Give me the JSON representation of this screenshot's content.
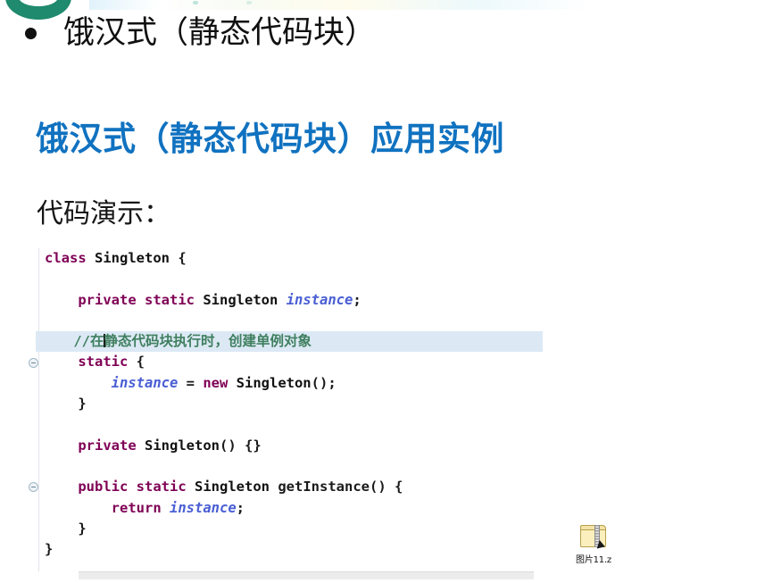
{
  "slide": {
    "bullet_title": "饿汉式（静态代码块）",
    "heading": "饿汉式（静态代码块）应用实例",
    "sub_label": "代码演示：",
    "heading_color": "#1072c0",
    "accent_ring_color": "#1f8a6d"
  },
  "code": {
    "language": "java",
    "highlight_background": "#dce9f5",
    "keyword_color": "#7f0055",
    "field_color": "#4a5fd4",
    "comment_color": "#3f7f5f",
    "lines": [
      {
        "tokens": [
          {
            "t": "class",
            "c": "kw"
          },
          {
            "t": " "
          },
          {
            "t": "Singleton",
            "c": "type"
          },
          {
            "t": " {"
          }
        ]
      },
      {
        "tokens": []
      },
      {
        "tokens": [
          {
            "t": "    "
          },
          {
            "t": "private",
            "c": "kw"
          },
          {
            "t": " "
          },
          {
            "t": "static",
            "c": "kw"
          },
          {
            "t": " "
          },
          {
            "t": "Singleton",
            "c": "type"
          },
          {
            "t": " "
          },
          {
            "t": "instance",
            "c": "field"
          },
          {
            "t": ";"
          }
        ]
      },
      {
        "tokens": []
      },
      {
        "highlight": true,
        "caret_after": "    //在",
        "tokens": [
          {
            "t": "    "
          },
          {
            "t": "//在静态代码块执行时，创建单例对象",
            "c": "cmt"
          }
        ]
      },
      {
        "fold": true,
        "tokens": [
          {
            "t": "    "
          },
          {
            "t": "static",
            "c": "kw"
          },
          {
            "t": " {"
          }
        ]
      },
      {
        "tokens": [
          {
            "t": "        "
          },
          {
            "t": "instance",
            "c": "field"
          },
          {
            "t": " = "
          },
          {
            "t": "new",
            "c": "kw"
          },
          {
            "t": " "
          },
          {
            "t": "Singleton",
            "c": "type"
          },
          {
            "t": "();"
          }
        ]
      },
      {
        "tokens": [
          {
            "t": "    }"
          }
        ]
      },
      {
        "tokens": []
      },
      {
        "tokens": [
          {
            "t": "    "
          },
          {
            "t": "private",
            "c": "kw"
          },
          {
            "t": " "
          },
          {
            "t": "Singleton",
            "c": "type"
          },
          {
            "t": "() {}"
          }
        ]
      },
      {
        "tokens": []
      },
      {
        "fold": true,
        "tokens": [
          {
            "t": "    "
          },
          {
            "t": "public",
            "c": "kw"
          },
          {
            "t": " "
          },
          {
            "t": "static",
            "c": "kw"
          },
          {
            "t": " "
          },
          {
            "t": "Singleton",
            "c": "type"
          },
          {
            "t": " getInstance() {"
          }
        ]
      },
      {
        "tokens": [
          {
            "t": "        "
          },
          {
            "t": "return",
            "c": "kw"
          },
          {
            "t": " "
          },
          {
            "t": "instance",
            "c": "field"
          },
          {
            "t": ";"
          }
        ]
      },
      {
        "tokens": [
          {
            "t": "    }"
          }
        ]
      },
      {
        "tokens": [
          {
            "t": "}"
          }
        ]
      }
    ]
  },
  "desktop_icon": {
    "name": "zip-archive-icon",
    "label": "图片11.z"
  }
}
